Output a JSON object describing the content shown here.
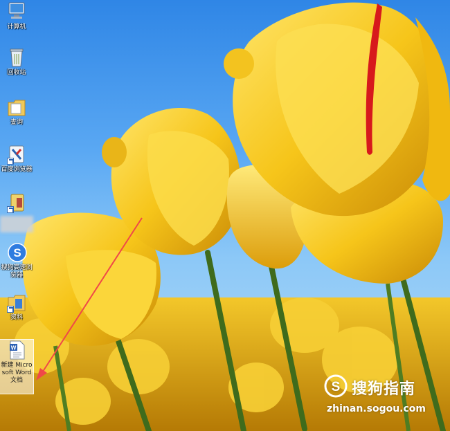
{
  "desktop": {
    "icons": [
      {
        "label": "计算机",
        "icon": "computer-icon"
      },
      {
        "label": "回收站",
        "icon": "recycle-bin-icon"
      },
      {
        "label": "查询",
        "icon": "folder-icon"
      },
      {
        "label": "百度浏览器",
        "icon": "browser-icon"
      },
      {
        "label": "",
        "icon": "app-shortcut-icon"
      },
      {
        "label": "搜狗高速浏览器",
        "icon": "sogou-browser-icon"
      },
      {
        "label": "资料",
        "icon": "folder-icon"
      },
      {
        "label": "新建 Microsoft Word 文档",
        "icon": "word-document-icon",
        "selected": true
      }
    ]
  },
  "watermark": {
    "brand_cn": "搜狗指南",
    "url": "zhinan.sogou.com"
  },
  "annotation": {
    "arrow_color": "#f04848"
  }
}
